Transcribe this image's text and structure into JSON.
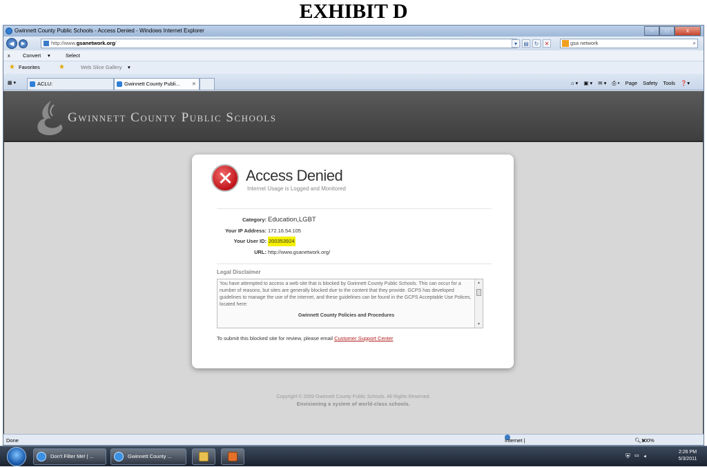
{
  "exhibit_label": "EXHIBIT D",
  "window": {
    "title": "Gwinnett County Public Schools - Access Denied - Windows Internet Explorer",
    "controls": {
      "minimize": "–",
      "maximize": "□",
      "close": "x"
    }
  },
  "address_bar": {
    "prefix": "http://www.",
    "domain": "gsanetwork.org",
    "suffix": "/",
    "search_value": "gsa network"
  },
  "command_bar": {
    "close": "x",
    "convert": "Convert",
    "select": "Select"
  },
  "favorites_bar": {
    "favorites": "Favorites",
    "web_slice": "Web Slice Gallery"
  },
  "tabs": [
    {
      "label": "ACLU:",
      "active": false
    },
    {
      "label": "Gwinnett County Publi...",
      "active": true
    }
  ],
  "tab_commands": [
    "Page",
    "Safety",
    "Tools"
  ],
  "page": {
    "org_name": "Gwinnett County Public Schools",
    "deny_title": "Access Denied",
    "deny_subtitle": "Internet Usage is Logged and Monitored",
    "info": {
      "category_label": "Category:",
      "category_value": "Education,LGBT",
      "ip_label": "Your IP Address:",
      "ip_value": "172.16.54.105",
      "user_label": "Your User ID:",
      "user_value": "200353924",
      "url_label": "URL:",
      "url_value": "http://www.gsanetwork.org/"
    },
    "legal": {
      "heading": "Legal Disclaimer",
      "text": "You have attempted to access a web site that is blocked by Gwinnett County Public Schools. This can occur for a number of reasons, but sites are generally blocked due to the content that they provide. GCPS has developed guidelines to manage the use of the internet, and these guidelines can be found in the GCPS Acceptable Use Polices, located here:",
      "policies_link": "Gwinnett County Policies and Procedures"
    },
    "submit_text": "To submit this blocked site for review, please email",
    "submit_link": "Customer Support Center",
    "copyright": "Copyright © 2009 Gwinnett County Public Schools. All Rights Reserved.",
    "tagline": "Envisioning a system of world-class schools."
  },
  "status_bar": {
    "left": "Done",
    "zone": "Internet | Protected Mode: Off",
    "zoom": "100%"
  },
  "taskbar": {
    "items": [
      {
        "label": "Don't Filter Me! | ..."
      },
      {
        "label": "Gwinnett County ..."
      }
    ],
    "time": "2:26 PM",
    "date": "5/3/2011"
  },
  "colors": {
    "denied_red": "#c0141a",
    "link_red": "#b01c1c",
    "highlight": "#f4f000",
    "header_gray": "#4a4a4a"
  }
}
